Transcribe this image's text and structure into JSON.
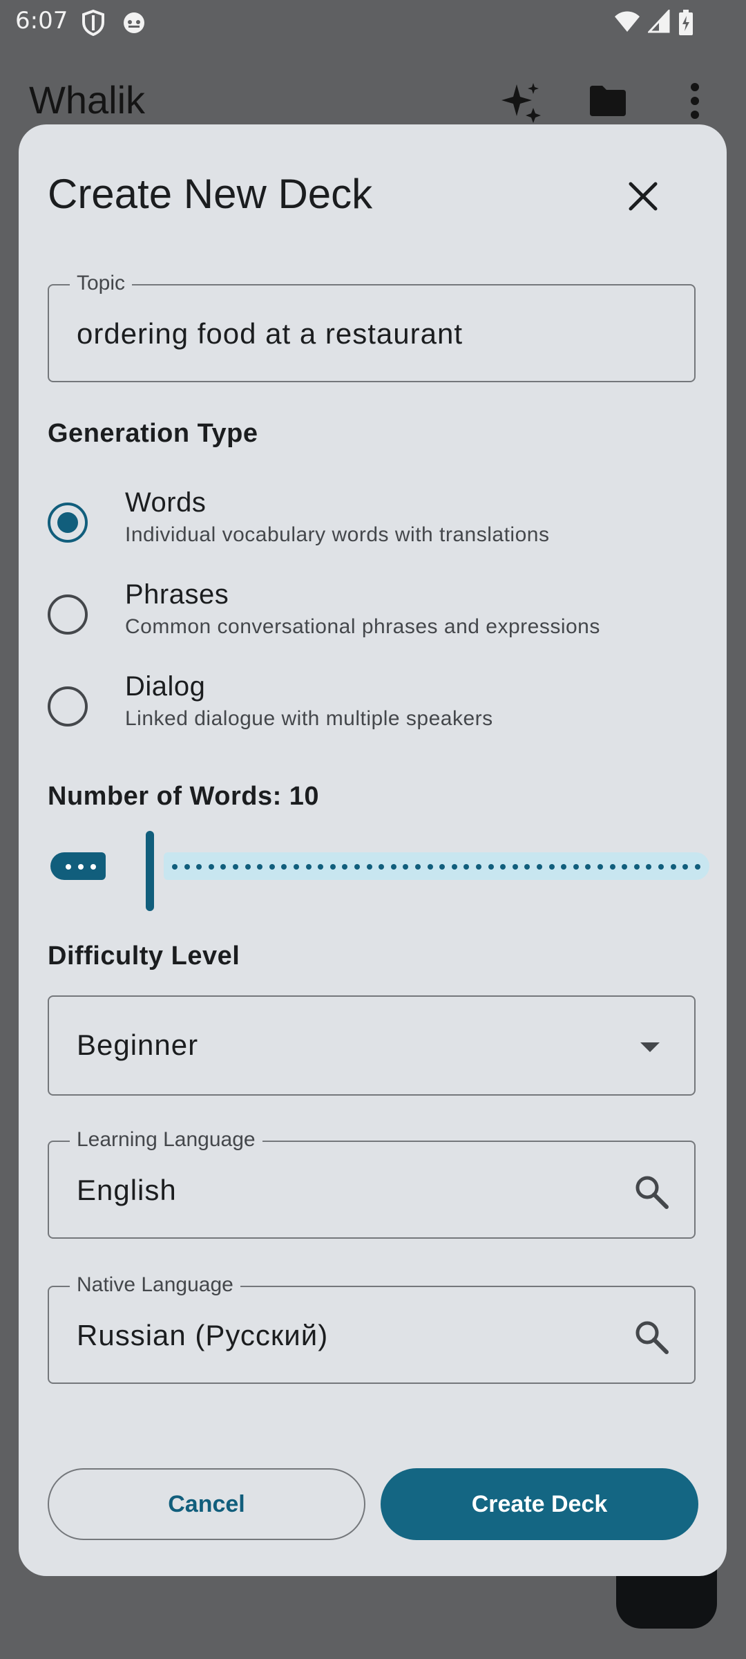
{
  "status_bar": {
    "time": "6:07"
  },
  "app_bar": {
    "title": "Whalik"
  },
  "dialog": {
    "title": "Create New Deck",
    "topic": {
      "label": "Topic",
      "value": "ordering food at a restaurant"
    },
    "generation_type": {
      "heading": "Generation Type",
      "options": [
        {
          "title": "Words",
          "subtitle": "Individual vocabulary words with translations",
          "selected": true
        },
        {
          "title": "Phrases",
          "subtitle": "Common conversational phrases and expressions",
          "selected": false
        },
        {
          "title": "Dialog",
          "subtitle": "Linked dialogue with multiple speakers",
          "selected": false
        }
      ]
    },
    "word_count": {
      "heading": "Number of Words: 10",
      "value": 10
    },
    "difficulty": {
      "heading": "Difficulty Level",
      "selected": "Beginner"
    },
    "learning_language": {
      "label": "Learning Language",
      "value": "English"
    },
    "native_language": {
      "label": "Native Language",
      "value": "Russian (Русский)"
    },
    "buttons": {
      "cancel": "Cancel",
      "create": "Create Deck"
    }
  },
  "colors": {
    "accent": "#115e7c",
    "dialog_bg": "#dfe2e6",
    "scrim": "#5f6062",
    "track": "#c8e6f0"
  }
}
